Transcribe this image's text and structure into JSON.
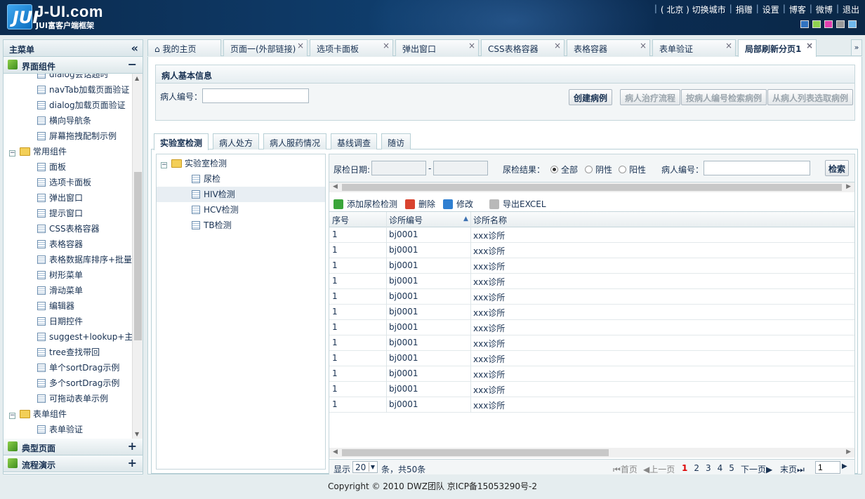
{
  "header": {
    "logo_mark": "JUI",
    "logo_title": "J-UI.com",
    "logo_subtitle": "JUI富客户端框架",
    "nav": [
      "( 北京 ) 切换城市",
      "捐赠",
      "设置",
      "博客",
      "微博",
      "退出"
    ],
    "theme_colors": [
      "#2f73c2",
      "#8fd14f",
      "#e23fb0",
      "#9a9a9a",
      "#6fb8ec"
    ]
  },
  "left": {
    "title": "主菜单",
    "collapse_icon": "«",
    "sections": [
      {
        "label": "界面组件",
        "sign": "−"
      },
      {
        "label": "典型页面",
        "sign": "+"
      },
      {
        "label": "流程演示",
        "sign": "+"
      }
    ],
    "tree": [
      {
        "label": "dialog会话超时",
        "type": "doc",
        "indent": 2
      },
      {
        "label": "navTab加载页面验证",
        "type": "doc",
        "indent": 2
      },
      {
        "label": "dialog加载页面验证",
        "type": "doc",
        "indent": 2
      },
      {
        "label": "横向导航条",
        "type": "doc",
        "indent": 2
      },
      {
        "label": "屏幕拖拽配制示例",
        "type": "doc",
        "indent": 2
      },
      {
        "label": "常用组件",
        "type": "folder",
        "indent": 1
      },
      {
        "label": "面板",
        "type": "doc",
        "indent": 2
      },
      {
        "label": "选项卡面板",
        "type": "doc",
        "indent": 2
      },
      {
        "label": "弹出窗口",
        "type": "doc",
        "indent": 2
      },
      {
        "label": "提示窗口",
        "type": "doc",
        "indent": 2
      },
      {
        "label": "CSS表格容器",
        "type": "doc",
        "indent": 2
      },
      {
        "label": "表格容器",
        "type": "doc",
        "indent": 2
      },
      {
        "label": "表格数据库排序+批量",
        "type": "doc",
        "indent": 2
      },
      {
        "label": "树形菜单",
        "type": "doc",
        "indent": 2
      },
      {
        "label": "滑动菜单",
        "type": "doc",
        "indent": 2
      },
      {
        "label": "编辑器",
        "type": "doc",
        "indent": 2
      },
      {
        "label": "日期控件",
        "type": "doc",
        "indent": 2
      },
      {
        "label": "suggest+lookup+主",
        "type": "doc",
        "indent": 2
      },
      {
        "label": "tree查找带回",
        "type": "doc",
        "indent": 2
      },
      {
        "label": "单个sortDrag示例",
        "type": "doc",
        "indent": 2
      },
      {
        "label": "多个sortDrag示例",
        "type": "doc",
        "indent": 2
      },
      {
        "label": "可拖动表单示例",
        "type": "doc",
        "indent": 2
      },
      {
        "label": "表单组件",
        "type": "folder",
        "indent": 1
      },
      {
        "label": "表单验证",
        "type": "doc",
        "indent": 2
      }
    ]
  },
  "tabs": [
    {
      "label": "我的主页",
      "closable": false,
      "active": false
    },
    {
      "label": "页面一(外部链接)",
      "closable": true,
      "active": false
    },
    {
      "label": "选项卡面板",
      "closable": true,
      "active": false
    },
    {
      "label": "弹出窗口",
      "closable": true,
      "active": false
    },
    {
      "label": "CSS表格容器",
      "closable": true,
      "active": false
    },
    {
      "label": "表格容器",
      "closable": true,
      "active": false
    },
    {
      "label": "表单验证",
      "closable": true,
      "active": false
    },
    {
      "label": "局部刷新分页1",
      "closable": true,
      "active": true
    }
  ],
  "tab_menu_icon": "»",
  "patient": {
    "title": "病人基本信息",
    "id_label": "病人编号：",
    "id_value": "",
    "buttons": [
      {
        "label": "创建病例",
        "disabled": false
      },
      {
        "label": "病人治疗流程",
        "disabled": true
      },
      {
        "label": "按病人编号检索病例",
        "disabled": true
      },
      {
        "label": "从病人列表选取病例",
        "disabled": true
      }
    ]
  },
  "subtabs": [
    "实验室检测",
    "病人处方",
    "病人服药情况",
    "基线调查",
    "随访"
  ],
  "labtree": {
    "root": "实验室检测",
    "children": [
      "尿检",
      "HIV检测",
      "HCV检测",
      "TB检测"
    ],
    "selected": "HIV检测"
  },
  "search": {
    "date_label": "尿检日期:",
    "date_sep": "-",
    "result_label": "尿检结果：",
    "options": [
      "全部",
      "阴性",
      "阳性"
    ],
    "selected": "全部",
    "patient_label": "病人编号：",
    "patient_value": "",
    "button": "检索"
  },
  "toolbar": [
    {
      "label": "添加尿检检测",
      "icon": "add-icon",
      "color": "#3aa53a"
    },
    {
      "label": "删除",
      "icon": "delete-icon",
      "color": "#d9432f"
    },
    {
      "label": "修改",
      "icon": "edit-icon",
      "color": "#2f7fd1"
    },
    {
      "label": "导出EXCEL",
      "icon": "export-icon",
      "color": "#b9b9b9"
    }
  ],
  "grid": {
    "columns": [
      "序号",
      "诊所编号",
      "诊所名称"
    ],
    "sort_indicator": "▲",
    "rows": [
      [
        "1",
        "bj0001",
        "xxx诊所"
      ],
      [
        "1",
        "bj0001",
        "xxx诊所"
      ],
      [
        "1",
        "bj0001",
        "xxx诊所"
      ],
      [
        "1",
        "bj0001",
        "xxx诊所"
      ],
      [
        "1",
        "bj0001",
        "xxx诊所"
      ],
      [
        "1",
        "bj0001",
        "xxx诊所"
      ],
      [
        "1",
        "bj0001",
        "xxx诊所"
      ],
      [
        "1",
        "bj0001",
        "xxx诊所"
      ],
      [
        "1",
        "bj0001",
        "xxx诊所"
      ],
      [
        "1",
        "bj0001",
        "xxx诊所"
      ],
      [
        "1",
        "bj0001",
        "xxx诊所"
      ],
      [
        "1",
        "bj0001",
        "xxx诊所"
      ]
    ]
  },
  "pager": {
    "show_label": "显示",
    "page_size": "20",
    "total_text": "条，共50条",
    "first": "首页",
    "prev": "上一页",
    "pages": [
      "1",
      "2",
      "3",
      "4",
      "5"
    ],
    "current": "1",
    "next": "下一页",
    "last": "末页",
    "goto_value": "1"
  },
  "footer": "Copyright © 2010 DWZ团队 京ICP备15053290号-2"
}
